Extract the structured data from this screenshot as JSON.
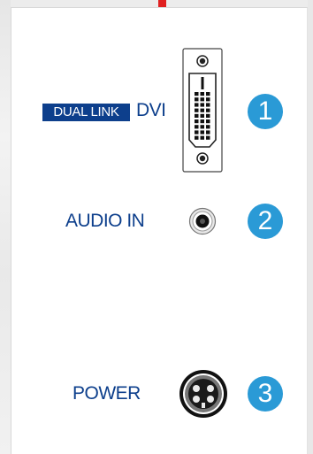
{
  "rows": [
    {
      "badge": "DUAL LINK",
      "label": "DVI",
      "number": "1",
      "connector": "dvi-connector"
    },
    {
      "label": "AUDIO IN",
      "number": "2",
      "connector": "audio-jack"
    },
    {
      "label": "POWER",
      "number": "3",
      "connector": "power-din-connector"
    }
  ],
  "colors": {
    "label_blue": "#0d3f8c",
    "number_badge_blue": "#2a9ad6",
    "marker_red": "#e02020"
  }
}
